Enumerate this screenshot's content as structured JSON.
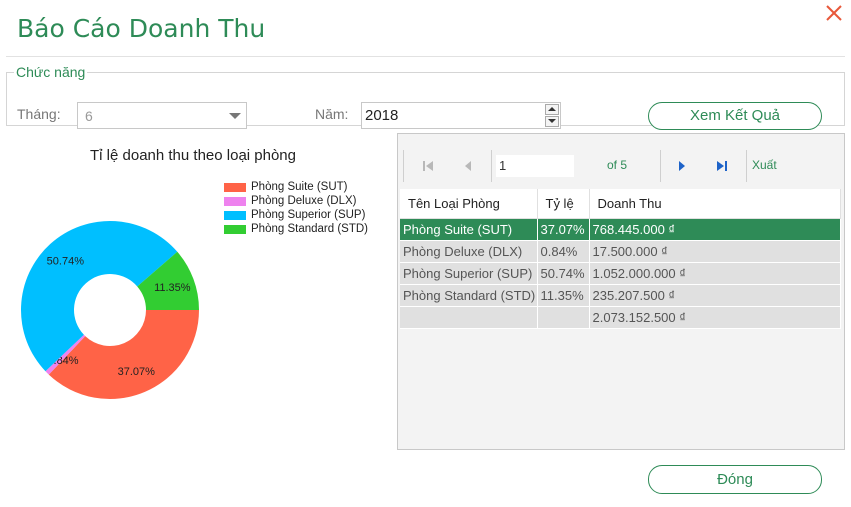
{
  "window": {
    "title": "Báo Cáo Doanh Thu"
  },
  "filter": {
    "legend": "Chức năng",
    "month_label": "Tháng:",
    "month_value": "6",
    "year_label": "Năm:",
    "year_value": "2018",
    "view_button": "Xem Kết Quả"
  },
  "chart_data": {
    "type": "pie",
    "title": "Tỉ lệ doanh thu theo loại phòng",
    "categories": [
      "Phòng Suite (SUT)",
      "Phòng Deluxe (DLX)",
      "Phòng Superior (SUP)",
      "Phòng Standard (STD)"
    ],
    "values": [
      37.07,
      0.84,
      50.74,
      11.35
    ],
    "labels": [
      "37.07%",
      "0.84%",
      "50.74%",
      "11.35%"
    ],
    "colors": [
      "#ff6347",
      "#ee82ee",
      "#00bfff",
      "#32cd32"
    ],
    "legend_position": "top-right",
    "donut": true
  },
  "pager": {
    "current_page": "1",
    "of_text": "of 5",
    "export_label": "Xuất"
  },
  "table": {
    "headers": [
      "Tên Loại Phòng",
      "Tỷ lệ",
      "Doanh Thu"
    ],
    "rows": [
      [
        "Phòng Suite (SUT)",
        "37.07%",
        "768.445.000 ₫"
      ],
      [
        "Phòng Deluxe (DLX)",
        "0.84%",
        "17.500.000 ₫"
      ],
      [
        "Phòng Superior (SUP)",
        "50.74%",
        "1.052.000.000 ₫"
      ],
      [
        "Phòng Standard (STD)",
        "11.35%",
        "235.207.500 ₫"
      ]
    ],
    "total": [
      "",
      "",
      "2.073.152.500 ₫"
    ]
  },
  "footer": {
    "close_button": "Đóng"
  },
  "icons": {
    "close": "close-x-icon",
    "first": "first-page-icon",
    "prev": "prev-page-icon",
    "next": "next-page-icon",
    "last": "last-page-icon"
  },
  "colors": {
    "accent": "#2e8b57",
    "close_x": "#e8583a"
  }
}
